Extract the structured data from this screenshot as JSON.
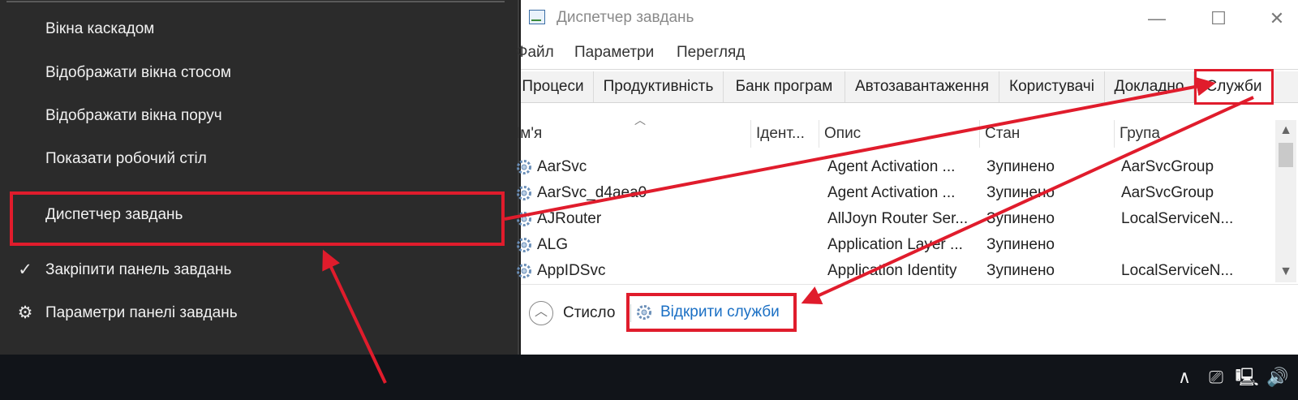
{
  "context_menu": {
    "items": [
      {
        "label": "Вікна каскадом",
        "icon": ""
      },
      {
        "label": "Відображати вікна стосом",
        "icon": ""
      },
      {
        "label": "Відображати вікна поруч",
        "icon": ""
      },
      {
        "label": "Показати робочий стіл",
        "icon": ""
      },
      {
        "label": "Диспетчер завдань",
        "icon": "",
        "highlighted": true
      },
      {
        "label": "Закріпити панель завдань",
        "icon": "checkmark-icon",
        "glyph": "✓"
      },
      {
        "label": "Параметри панелі завдань",
        "icon": "gear-icon",
        "glyph": "⚙"
      }
    ]
  },
  "task_manager": {
    "title": "Диспетчер завдань",
    "menu": [
      "Файл",
      "Параметри",
      "Перегляд"
    ],
    "tabs": [
      "Процеси",
      "Продуктивність",
      "Банк програм",
      "Автозавантаження",
      "Користувачі",
      "Докладно",
      "Служби"
    ],
    "active_tab": "Служби",
    "columns": [
      "Ім'я",
      "Ідент...",
      "Опис",
      "Стан",
      "Група"
    ],
    "rows": [
      {
        "name": "AarSvc",
        "pid": "",
        "desc": "Agent Activation ...",
        "status": "Зупинено",
        "group": "AarSvcGroup"
      },
      {
        "name": "AarSvc_d4aea0",
        "pid": "",
        "desc": "Agent Activation ...",
        "status": "Зупинено",
        "group": "AarSvcGroup"
      },
      {
        "name": "AJRouter",
        "pid": "",
        "desc": "AllJoyn Router Ser...",
        "status": "Зупинено",
        "group": "LocalServiceN..."
      },
      {
        "name": "ALG",
        "pid": "",
        "desc": "Application Layer ...",
        "status": "Зупинено",
        "group": ""
      },
      {
        "name": "AppIDSvc",
        "pid": "",
        "desc": "Application Identity",
        "status": "Зупинено",
        "group": "LocalServiceN..."
      }
    ],
    "fewer_details": "Стисло",
    "open_services": "Відкрити служби"
  },
  "taskbar": {
    "tray_icons": [
      "chevron-up-icon",
      "meet-now-icon",
      "network-icon",
      "volume-icon"
    ],
    "tray_glyphs": [
      "∧",
      "⎚",
      "🖳",
      "🔊"
    ]
  },
  "colors": {
    "accent_red": "#e01c2c",
    "menu_bg": "#2b2b2b",
    "taskbar_bg": "#111419",
    "link_blue": "#1a6fc4"
  }
}
